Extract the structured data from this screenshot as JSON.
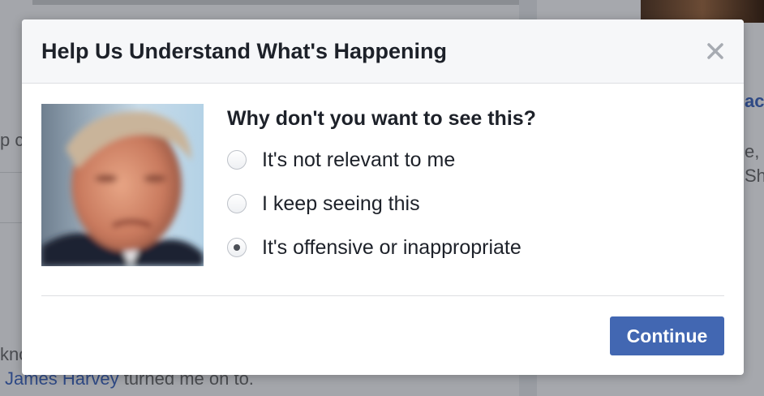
{
  "background": {
    "left_fragment_1": "p c",
    "left_fragment_2": "kno",
    "left_bottom_link": "James Harvey",
    "left_bottom_text": " turned me on to.",
    "right_fragment_1": "acl",
    "right_fragment_2": "e, w",
    "right_fragment_3": "Sh"
  },
  "dialog": {
    "title": "Help Us Understand What's Happening",
    "close_icon": "close-icon",
    "question": "Why don't you want to see this?",
    "options": [
      {
        "label": "It's not relevant to me",
        "checked": false
      },
      {
        "label": "I keep seeing this",
        "checked": false
      },
      {
        "label": "It's offensive or inappropriate",
        "checked": true
      }
    ],
    "continue_label": "Continue"
  },
  "colors": {
    "accent": "#4267b2",
    "header_bg": "#f6f7f9",
    "text": "#1d2129",
    "overlay": "#9a9da3"
  }
}
